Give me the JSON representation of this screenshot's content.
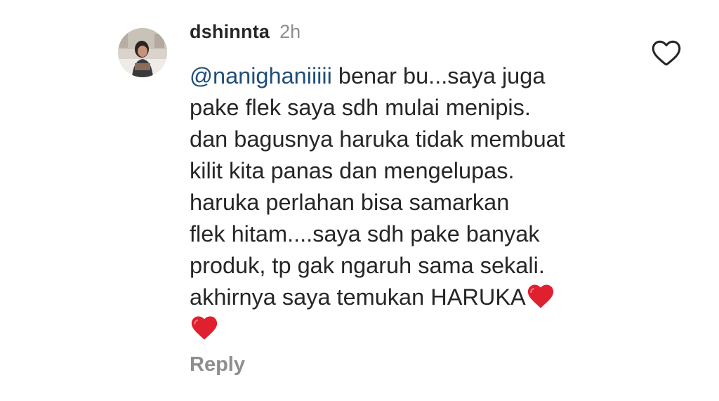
{
  "comment": {
    "username": "dshinnta",
    "timestamp": "2h",
    "mention": "@nanighaniiiii",
    "lines": [
      " benar bu...saya juga",
      "pake flek saya sdh mulai menipis.",
      "dan bagusnya haruka tidak membuat",
      "kilit kita panas dan mengelupas.",
      "haruka perlahan bisa samarkan",
      "flek hitam....saya sdh pake banyak",
      "produk, tp gak ngaruh sama sekali.",
      "akhirnya saya temukan HARUKA"
    ],
    "emoji": [
      "red-heart",
      "red-heart"
    ],
    "reply_label": "Reply",
    "like_icon": "heart-outline-icon",
    "colors": {
      "text": "#262626",
      "muted": "#8e8e8e",
      "mention": "#1f4e79",
      "heart": "#e0202f"
    }
  }
}
